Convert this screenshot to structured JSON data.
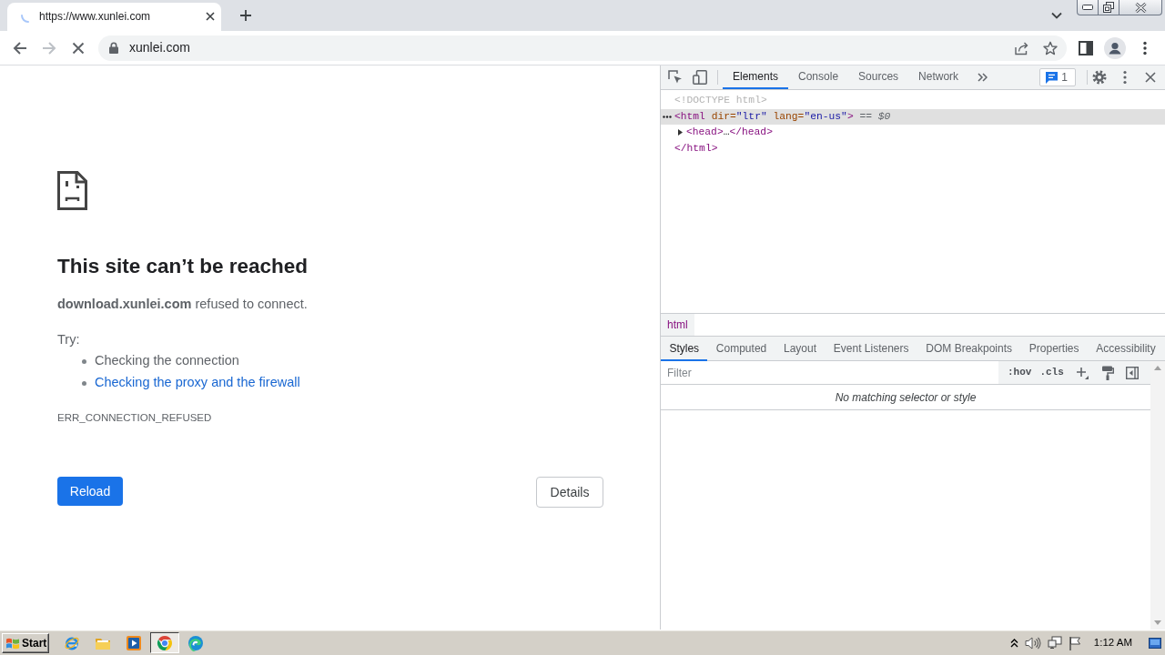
{
  "browser": {
    "tabs": [
      {
        "title": "https://www.xunlei.com",
        "loading": true,
        "selected": true
      }
    ],
    "nav_buttons": [
      {
        "kind": "back",
        "disabled": false
      },
      {
        "kind": "forward",
        "disabled": true
      },
      {
        "kind": "stop",
        "disabled": false
      }
    ],
    "secure": true,
    "address": "xunlei.com"
  },
  "error_page": {
    "title": "This site can’t be reached",
    "message": "**download.xunlei.com** refused to connect.",
    "try_label": "Try:",
    "suggestions": [
      {
        "kind": "text",
        "text": "Checking the connection"
      },
      {
        "kind": "link",
        "text": "Checking the proxy and the firewall"
      }
    ],
    "error_code": "ERR_CONNECTION_REFUSED",
    "primary_button": "Reload",
    "secondary_button": "Details"
  },
  "devtools": {
    "tabs": [
      {
        "label": "Elements",
        "selected": true
      },
      {
        "label": "Console",
        "selected": false
      },
      {
        "label": "Sources",
        "selected": false
      },
      {
        "label": "Network",
        "selected": false
      }
    ],
    "issues_count": "1",
    "dom": [
      {
        "tokens": [
          {
            "kind": "doctype",
            "text": "<!DOCTYPE html>"
          }
        ],
        "selected": false
      },
      {
        "tokens": [
          {
            "kind": "tag",
            "text": "<html"
          },
          {
            "kind": "attr",
            "text": " dir="
          },
          {
            "kind": "value",
            "text": "\"ltr\""
          },
          {
            "kind": "attr",
            "text": " lang="
          },
          {
            "kind": "value",
            "text": "\"en-us\""
          },
          {
            "kind": "tag",
            "text": ">"
          },
          {
            "kind": "ref",
            "text": " == $0"
          }
        ],
        "selected": true,
        "children": [
          {
            "tokens": [
              {
                "kind": "tag",
                "text": "<head>"
              },
              {
                "kind": "text",
                "text": "…"
              },
              {
                "kind": "tag",
                "text": "</head>"
              }
            ],
            "selected": false,
            "expanded": false
          }
        ],
        "closing": [
          {
            "kind": "tag",
            "text": "</html>"
          }
        ]
      }
    ],
    "breadcrumbs": [
      {
        "label": "html",
        "selected": true
      }
    ],
    "sidebar_tabs": [
      {
        "label": "Styles",
        "selected": true
      },
      {
        "label": "Computed",
        "selected": false
      },
      {
        "label": "Layout",
        "selected": false
      },
      {
        "label": "Event Listeners",
        "selected": false
      },
      {
        "label": "DOM Breakpoints",
        "selected": false
      },
      {
        "label": "Properties",
        "selected": false
      },
      {
        "label": "Accessibility",
        "selected": false
      }
    ],
    "filter": {
      "placeholder": "Filter"
    },
    "hov_toggle": ":hov",
    "cls_toggle": ".cls",
    "empty_message": "No matching selector or style"
  },
  "taskbar": {
    "start": "Start",
    "apps": [
      {
        "kind": "e-browser",
        "active": false
      },
      {
        "kind": "folder",
        "active": false
      },
      {
        "kind": "media",
        "active": false
      },
      {
        "kind": "ring-browser",
        "active": true
      },
      {
        "kind": "wave-browser",
        "active": false
      }
    ],
    "clock": "1:12 AM"
  }
}
